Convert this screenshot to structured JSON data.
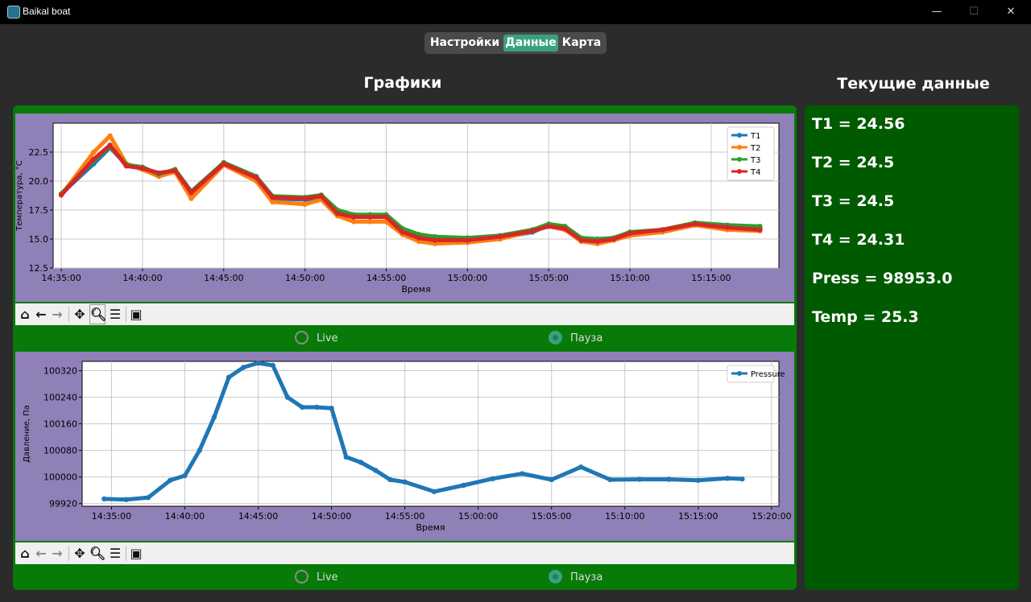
{
  "window": {
    "title": "Baikal boat",
    "minimize": "—",
    "maximize": "☐",
    "close": "✕"
  },
  "tabs": [
    {
      "label": "Настройки",
      "active": false
    },
    {
      "label": "Данные",
      "active": true
    },
    {
      "label": "Карта",
      "active": false
    }
  ],
  "sections": {
    "charts_title": "Графики",
    "current_title": "Текущие данные"
  },
  "toolbar_icons": [
    "home-icon",
    "back-arrow-icon",
    "forward-arrow-icon",
    "pan-icon",
    "zoom-icon",
    "configure-icon",
    "save-icon"
  ],
  "radio": {
    "live": "Live",
    "pause": "Пауза",
    "selected": "pause"
  },
  "current_data": [
    "T1 = 24.56",
    "T2 = 24.5",
    "T3 = 24.5",
    "T4 = 24.31",
    "Press = 98953.0",
    "Temp = 25.3"
  ],
  "colors": {
    "accent": "#3aa17e",
    "panel": "#087a08",
    "current_panel": "#005a00",
    "plot_bg": "#9080b8"
  },
  "chart_data": [
    {
      "type": "line",
      "xlabel": "Время",
      "ylabel": "Температура, °С",
      "x_ticks": [
        "14:35:00",
        "14:40:00",
        "14:45:00",
        "14:50:00",
        "14:55:00",
        "15:00:00",
        "15:05:00",
        "15:10:00",
        "15:15:00"
      ],
      "y_ticks": [
        12.5,
        15.0,
        17.5,
        20.0,
        22.5
      ],
      "xlim": [
        "14:34:30",
        "15:19:10"
      ],
      "ylim": [
        12.5,
        25.0
      ],
      "grid": true,
      "legend_position": "top-right",
      "x": [
        "14:35:00",
        "14:37:00",
        "14:38:00",
        "14:39:00",
        "14:40:00",
        "14:41:00",
        "14:42:00",
        "14:43:00",
        "14:45:00",
        "14:47:00",
        "14:48:00",
        "14:50:00",
        "14:51:00",
        "14:52:00",
        "14:53:00",
        "14:54:00",
        "14:55:00",
        "14:56:00",
        "14:57:00",
        "14:58:00",
        "15:00:00",
        "15:02:00",
        "15:04:00",
        "15:05:00",
        "15:06:00",
        "15:07:00",
        "15:08:00",
        "15:09:00",
        "15:10:00",
        "15:12:00",
        "15:14:00",
        "15:16:00",
        "15:18:00"
      ],
      "series": [
        {
          "name": "T1",
          "color": "#1f77b4",
          "values": [
            18.9,
            21.5,
            22.9,
            21.4,
            21.2,
            20.5,
            21.0,
            19.0,
            21.4,
            20.2,
            18.5,
            18.4,
            18.6,
            17.3,
            17.0,
            17.0,
            17.0,
            15.8,
            15.2,
            15.0,
            14.9,
            15.1,
            15.6,
            16.2,
            16.0,
            15.0,
            14.9,
            15.0,
            15.5,
            15.7,
            16.3,
            16.1,
            16.0
          ]
        },
        {
          "name": "T2",
          "color": "#ff7f0e",
          "values": [
            18.8,
            22.5,
            23.9,
            21.5,
            21.0,
            20.4,
            20.8,
            18.5,
            21.4,
            20.0,
            18.2,
            18.0,
            18.4,
            17.0,
            16.5,
            16.5,
            16.5,
            15.4,
            14.8,
            14.6,
            14.7,
            15.0,
            15.7,
            16.1,
            15.8,
            14.8,
            14.6,
            14.9,
            15.3,
            15.6,
            16.2,
            15.8,
            15.7
          ]
        },
        {
          "name": "T3",
          "color": "#2ca02c",
          "values": [
            18.9,
            21.8,
            23.0,
            21.4,
            21.2,
            20.6,
            21.0,
            19.1,
            21.6,
            20.4,
            18.7,
            18.6,
            18.8,
            17.5,
            17.1,
            17.1,
            17.1,
            15.9,
            15.4,
            15.2,
            15.1,
            15.3,
            15.8,
            16.3,
            16.1,
            15.1,
            15.0,
            15.1,
            15.6,
            15.8,
            16.4,
            16.2,
            16.1
          ]
        },
        {
          "name": "T4",
          "color": "#d62728",
          "values": [
            18.8,
            21.9,
            23.1,
            21.3,
            21.1,
            20.7,
            20.9,
            19.0,
            21.5,
            20.3,
            18.6,
            18.5,
            18.7,
            17.2,
            16.9,
            16.9,
            16.9,
            15.6,
            15.1,
            14.9,
            14.9,
            15.2,
            15.7,
            16.1,
            15.9,
            14.9,
            14.8,
            15.0,
            15.5,
            15.8,
            16.3,
            16.0,
            15.8
          ]
        }
      ]
    },
    {
      "type": "line",
      "xlabel": "Время",
      "ylabel": "Давление, Па",
      "x_ticks": [
        "14:35:00",
        "14:40:00",
        "14:45:00",
        "14:50:00",
        "14:55:00",
        "15:00:00",
        "15:05:00",
        "15:10:00",
        "15:15:00",
        "15:20:00"
      ],
      "y_ticks": [
        99920,
        100000,
        100080,
        100160,
        100240,
        100320
      ],
      "xlim": [
        "14:33:00",
        "15:20:30"
      ],
      "ylim": [
        99912,
        100348
      ],
      "grid": true,
      "legend_position": "top-right",
      "x": [
        "14:34:30",
        "14:36:00",
        "14:37:30",
        "14:39:00",
        "14:40:00",
        "14:41:00",
        "14:42:00",
        "14:43:00",
        "14:44:00",
        "14:45:00",
        "14:46:00",
        "14:47:00",
        "14:48:00",
        "14:49:00",
        "14:50:00",
        "14:51:00",
        "14:52:00",
        "14:53:00",
        "14:54:00",
        "14:55:00",
        "14:57:00",
        "14:59:00",
        "15:01:00",
        "15:03:00",
        "15:05:00",
        "15:07:00",
        "15:09:00",
        "15:11:00",
        "15:13:00",
        "15:15:00",
        "15:17:00",
        "15:18:00"
      ],
      "series": [
        {
          "name": "Pressure",
          "color": "#1f77b4",
          "values": [
            99934,
            99932,
            99938,
            99990,
            100004,
            100080,
            100180,
            100300,
            100330,
            100343,
            100336,
            100240,
            100210,
            100210,
            100207,
            100060,
            100044,
            100020,
            99992,
            99985,
            99956,
            99975,
            99995,
            100010,
            99992,
            100030,
            99992,
            99993,
            99993,
            99990,
            99996,
            99994
          ]
        }
      ]
    }
  ]
}
